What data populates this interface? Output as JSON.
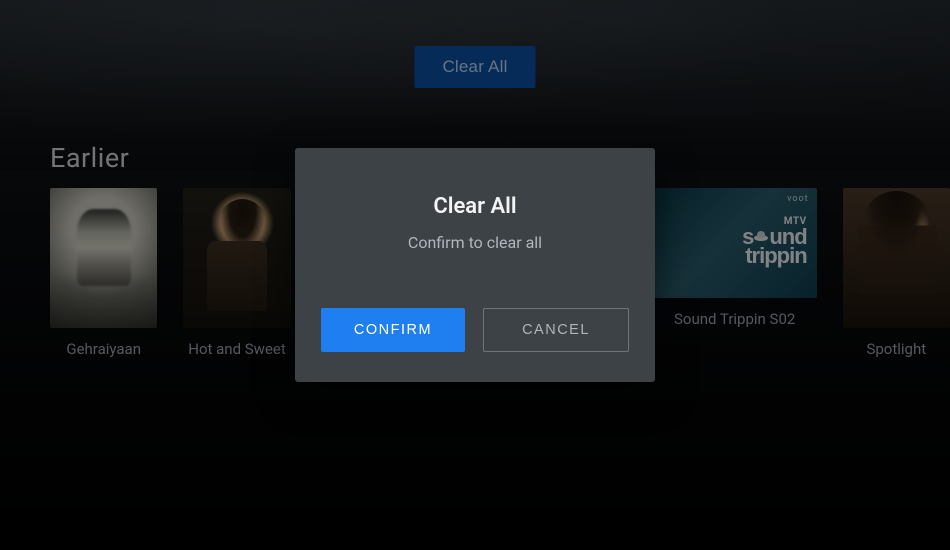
{
  "header": {
    "clear_all_label": "Clear All"
  },
  "section": {
    "title": "Earlier"
  },
  "cards": [
    {
      "label": "Gehraiyaan"
    },
    {
      "label": "Hot and Sweet"
    },
    {
      "label": "Sound Trippin S02",
      "overlay_brand": "voot",
      "logo_network": "MTV",
      "logo_line1_a": "s",
      "logo_line1_b": "und",
      "logo_line2": "trippin"
    },
    {
      "label": "Spotlight"
    }
  ],
  "dialog": {
    "title": "Clear All",
    "message": "Confirm to clear all",
    "confirm_label": "CONFIRM",
    "cancel_label": "CANCEL"
  },
  "colors": {
    "primary_button": "#1f7ef0",
    "top_button": "#0e4fa3",
    "dialog_bg": "#3d4247"
  }
}
